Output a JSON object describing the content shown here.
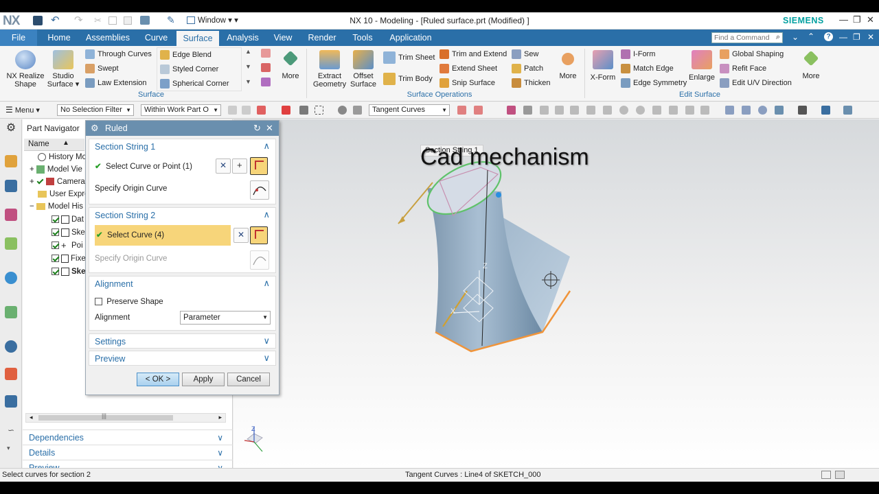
{
  "app": {
    "logo": "NX",
    "title": "NX 10 - Modeling - [Ruled surface.prt (Modified) ]",
    "brand": "SIEMENS",
    "window_menu": "Window",
    "search_placeholder": "Find a Command",
    "colors": {
      "accent": "#2a6fa8",
      "brand": "#00a0a0",
      "highlight": "#f7d57a"
    }
  },
  "menubar": {
    "file": "File",
    "tabs": [
      "Home",
      "Assemblies",
      "Curve",
      "Surface",
      "Analysis",
      "View",
      "Render",
      "Tools",
      "Application"
    ],
    "active_tab": "Surface"
  },
  "ribbon": {
    "surface_group": {
      "label": "Surface",
      "nx_realize_1": "NX Realize",
      "nx_realize_2": "Shape",
      "studio_1": "Studio",
      "studio_2": "Surface ▾",
      "small": [
        "Through Curves",
        "Swept",
        "Law Extension",
        "Edge Blend",
        "Styled Corner",
        "Spherical Corner"
      ],
      "more": "More"
    },
    "operations_group": {
      "label": "Surface Operations",
      "extract_1": "Extract",
      "extract_2": "Geometry",
      "offset_1": "Offset",
      "offset_2": "Surface",
      "trim_sheet": "Trim Sheet",
      "trim_body": "Trim Body",
      "small": [
        "Trim and Extend",
        "Extend Sheet",
        "Snip Surface",
        "Sew",
        "Patch",
        "Thicken"
      ],
      "more": "More"
    },
    "edit_group": {
      "label": "Edit Surface",
      "xform": "X-Form",
      "enlarge": "Enlarge",
      "small": [
        "I-Form",
        "Match Edge",
        "Edge Symmetry",
        "Global Shaping",
        "Refit Face",
        "Edit U/V Direction"
      ],
      "more": "More"
    }
  },
  "toolbar2": {
    "menu": "Menu ▾",
    "filter": "No Selection Filter",
    "scope": "Within Work Part O",
    "curve_rule": "Tangent Curves"
  },
  "part_navigator": {
    "title": "Part Navigator",
    "column": "Name",
    "items": [
      "History Mo",
      "Model Vie",
      "Camera",
      "User Expre",
      "Model His",
      "Dat",
      "Ske",
      "Poi",
      "Fixe",
      "Ske"
    ],
    "panels": [
      "Dependencies",
      "Details",
      "Preview"
    ]
  },
  "dialog": {
    "title": "Ruled",
    "section1": {
      "header": "Section String 1",
      "select": "Select Curve or Point (1)",
      "origin": "Specify Origin Curve"
    },
    "section2": {
      "header": "Section String 2",
      "select": "Select Curve (4)",
      "origin": "Specify Origin Curve"
    },
    "alignment": {
      "header": "Alignment",
      "preserve": "Preserve Shape",
      "label": "Alignment",
      "value": "Parameter"
    },
    "settings": "Settings",
    "preview": "Preview",
    "ok": "< OK >",
    "apply": "Apply",
    "cancel": "Cancel"
  },
  "viewport": {
    "overlay_title": "Cad mechanism",
    "tooltip": "Section String 1",
    "axis_x": "X",
    "axis_z": "Z"
  },
  "status": {
    "prompt": "Select curves for section 2",
    "info": "Tangent Curves : Line4 of SKETCH_000"
  }
}
